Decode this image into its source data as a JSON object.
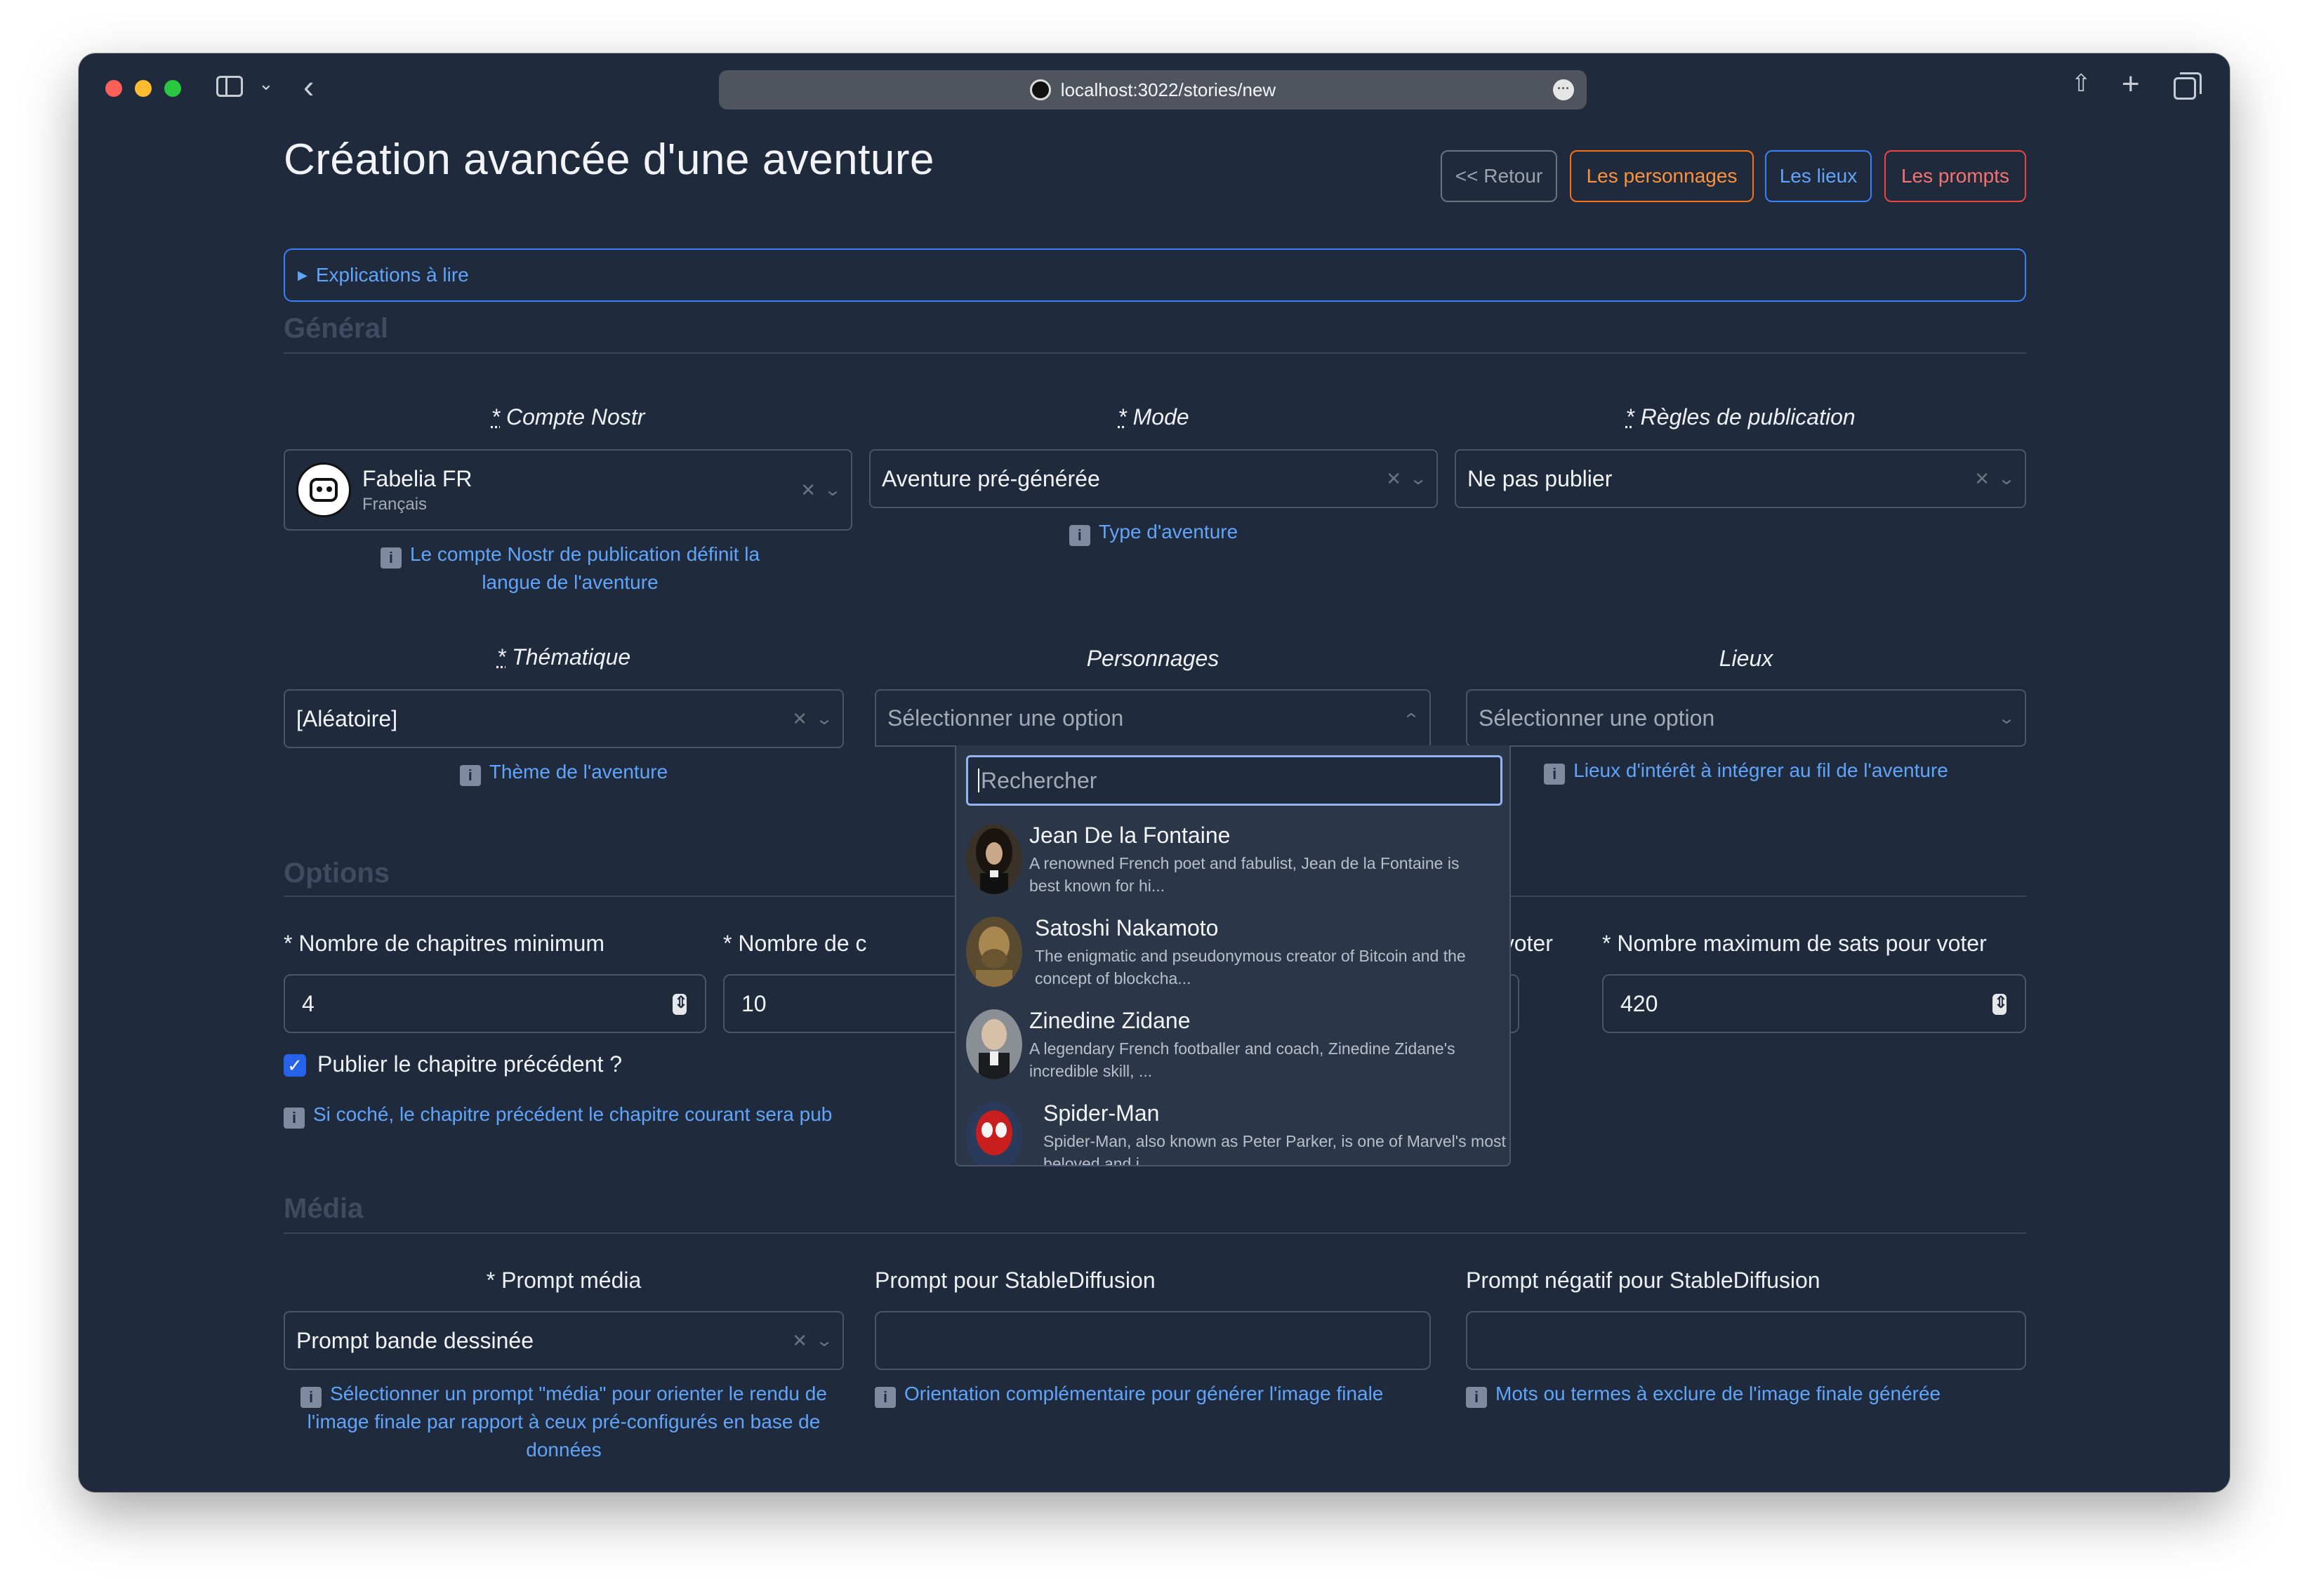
{
  "browser": {
    "url": "localhost:3022/stories/new"
  },
  "page": {
    "title": "Création avancée d'une aventure",
    "nav": {
      "retour": "<< Retour",
      "personnages": "Les personnages",
      "lieux": "Les lieux",
      "prompts": "Les prompts"
    },
    "explanations": "Explications à lire"
  },
  "general": {
    "title": "Général",
    "compte_nostr": {
      "label": "Compte Nostr",
      "value": "Fabelia FR",
      "sub": "Français",
      "help": "Le compte Nostr de publication définit la langue de l'aventure"
    },
    "mode": {
      "label": "Mode",
      "value": "Aventure pré-générée",
      "help": "Type d'aventure"
    },
    "regles": {
      "label": "Règles de publication",
      "value": "Ne pas publier"
    },
    "thematique": {
      "label": "Thématique",
      "value": "[Aléatoire]",
      "help": "Thème de l'aventure"
    },
    "personnages": {
      "label": "Personnages",
      "placeholder": "Sélectionner une option",
      "search_placeholder": "Rechercher",
      "options": [
        {
          "name": "Jean De la Fontaine",
          "desc": "A renowned French poet and fabulist, Jean de la Fontaine is best known for hi..."
        },
        {
          "name": "Satoshi Nakamoto",
          "desc": "The enigmatic and pseudonymous creator of Bitcoin and the concept of blockcha..."
        },
        {
          "name": "Zinedine Zidane",
          "desc": "A legendary French footballer and coach, Zinedine Zidane's incredible skill, ..."
        },
        {
          "name": "Spider-Man",
          "desc": "Spider-Man, also known as Peter Parker, is one of Marvel's most beloved and i..."
        }
      ]
    },
    "lieux": {
      "label": "Lieux",
      "placeholder": "Sélectionner une option",
      "help": "Lieux d'intérêt à intégrer au fil de l'aventure"
    }
  },
  "options": {
    "title": "Options",
    "min_chapitres": {
      "label": "Nombre de chapitres minimum",
      "value": "4"
    },
    "max_chapitres": {
      "label": "Nombre de c",
      "value": "10"
    },
    "min_sats": {
      "label": "ts pour voter",
      "value": ""
    },
    "max_sats": {
      "label": "Nombre maximum de sats pour voter",
      "value": "420"
    },
    "publier_precedent": {
      "label": "Publier le chapitre précédent ?",
      "checked": true,
      "help": "Si coché, le chapitre précédent le chapitre courant sera pub"
    }
  },
  "media": {
    "title": "Média",
    "prompt_media": {
      "label": "Prompt média",
      "value": "Prompt bande dessinée",
      "help": "Sélectionner un prompt \"média\" pour orienter le rendu de l'image finale par rapport à ceux pré-configurés en base de données"
    },
    "prompt_sd": {
      "label": "Prompt pour StableDiffusion",
      "value": "",
      "help": "Orientation complémentaire pour générer l'image finale"
    },
    "prompt_neg": {
      "label": "Prompt négatif pour StableDiffusion",
      "value": "",
      "help": "Mots ou termes à exclure de l'image finale générée"
    }
  },
  "required_marker": "*",
  "colors": {
    "background": "#1f2a3d",
    "accent_blue": "#60a5fa",
    "orange": "#fb923c",
    "red": "#f87171",
    "checkbox": "#2563eb"
  }
}
